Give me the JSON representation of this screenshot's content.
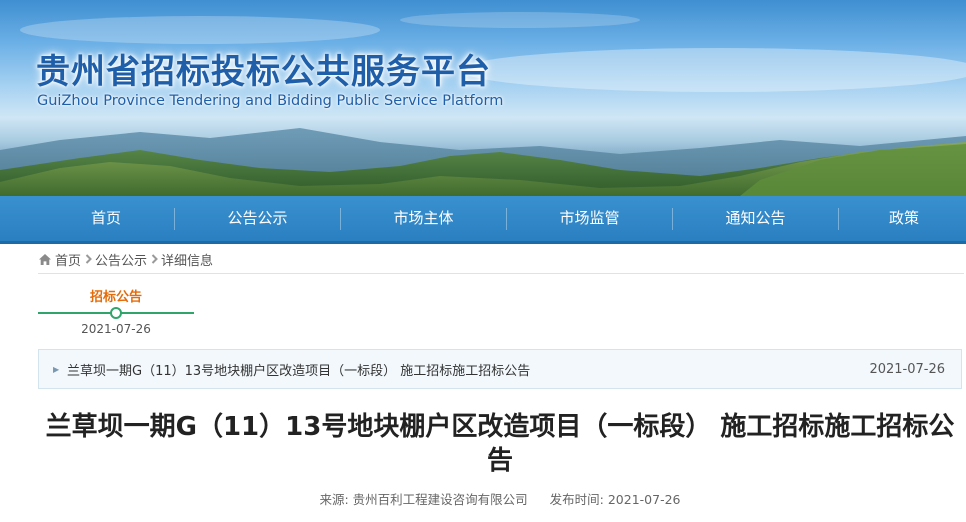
{
  "banner": {
    "title": "贵州省招标投标公共服务平台",
    "subtitle": "GuiZhou Province Tendering and Bidding Public Service Platform"
  },
  "nav": {
    "items": [
      {
        "label": "首页"
      },
      {
        "label": "公告公示"
      },
      {
        "label": "市场主体"
      },
      {
        "label": "市场监管"
      },
      {
        "label": "通知公告"
      },
      {
        "label": "政策"
      }
    ]
  },
  "breadcrumb": {
    "home_icon": "home-icon",
    "separator_icon": "chevron-right-icon",
    "items": [
      "首页",
      "公告公示",
      "详细信息"
    ]
  },
  "timeline": {
    "label": "招标公告",
    "date": "2021-07-26"
  },
  "notice": {
    "title": "兰草坝一期G（11）13号地块棚户区改造项目（一标段） 施工招标施工招标公告",
    "date": "2021-07-26"
  },
  "article": {
    "title": "兰草坝一期G（11）13号地块棚户区改造项目（一标段） 施工招标施工招标公告",
    "source_label": "来源:",
    "source": "贵州百利工程建设咨询有限公司",
    "published_label": "发布时间:",
    "published": "2021-07-26"
  },
  "colors": {
    "nav_bg": "#2a7fc0",
    "title_blue": "#1f5ea8",
    "timeline_green": "#2fa56b",
    "timeline_orange": "#e46c0a"
  }
}
